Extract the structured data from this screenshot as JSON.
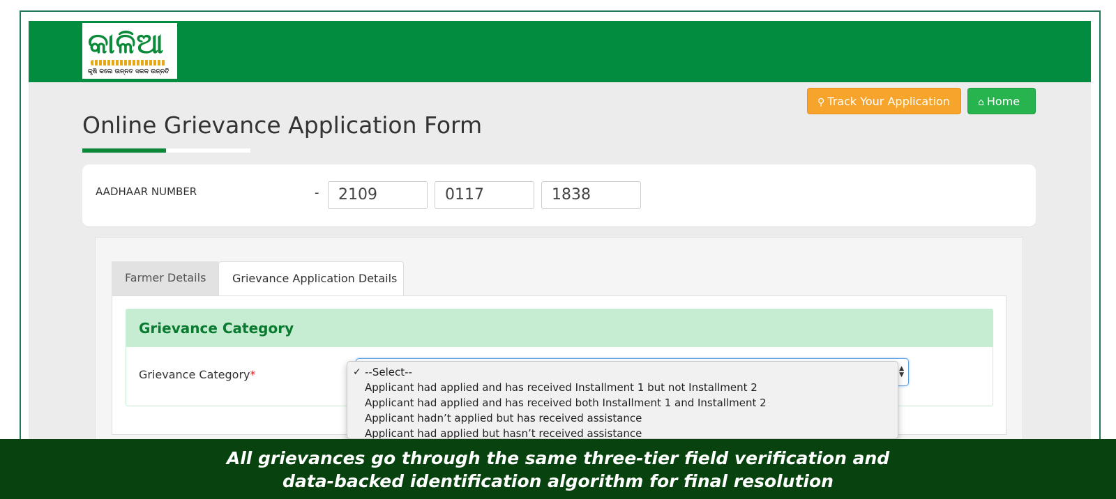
{
  "header": {
    "logo_text": "କାଳିଆ",
    "logo_tagline": "କୃଷି କଲେ ଉନ୍ନତ ସକଳ ଉନ୍ନତି"
  },
  "buttons": {
    "track_label": "Track Your Application",
    "track_icon": "map-marker-icon",
    "home_label": "Home",
    "home_icon": "home-icon"
  },
  "page": {
    "title": "Online Grievance Application Form"
  },
  "aadhaar": {
    "label": "AADHAAR NUMBER",
    "separator": "-",
    "parts": [
      "2109",
      "0117",
      "1838"
    ]
  },
  "tabs": [
    {
      "label": "Farmer Details",
      "active": false
    },
    {
      "label": "Grievance Application Details",
      "active": true
    }
  ],
  "grievance": {
    "section_heading": "Grievance Category",
    "field_label": "Grievance Category",
    "required_mark": "*",
    "options": [
      "--Select--",
      "Applicant had applied and has received Installment 1 but not Installment 2",
      "Applicant had applied and has received both Installment 1 and Installment 2",
      "Applicant hadn’t applied but has received assistance",
      "Applicant had applied but hasn’t received assistance"
    ],
    "selected_index": 0,
    "check_mark": "✓"
  },
  "caption": {
    "line1": "All grievances go through the same three-tier field verification and",
    "line2": "data-backed identification algorithm for final resolution"
  },
  "colors": {
    "brand_green": "#028c40",
    "track_orange": "#f7a42c",
    "home_green": "#27b44f",
    "caption_bg": "#08420f",
    "section_green": "#c6ecd2"
  }
}
